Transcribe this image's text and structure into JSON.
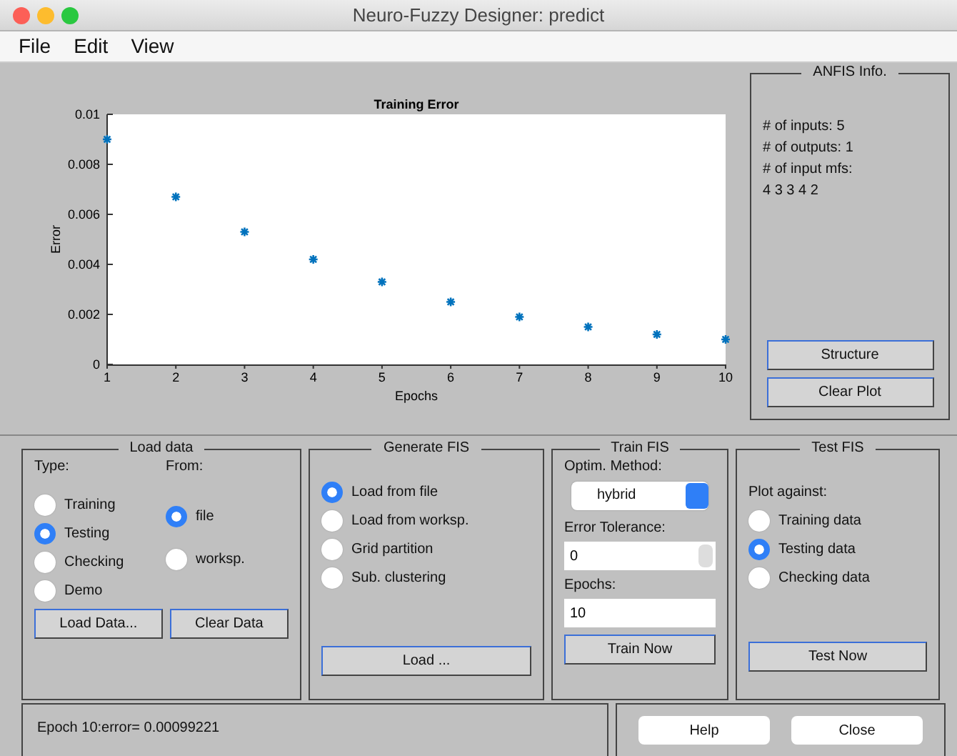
{
  "window": {
    "title": "Neuro-Fuzzy Designer: predict"
  },
  "menu": [
    "File",
    "Edit",
    "View"
  ],
  "chart_data": {
    "type": "scatter",
    "title": "Training Error",
    "xlabel": "Epochs",
    "ylabel": "Error",
    "x": [
      1,
      2,
      3,
      4,
      5,
      6,
      7,
      8,
      9,
      10
    ],
    "series": [
      {
        "color": "#0072bd",
        "values": [
          0.009,
          0.0067,
          0.0053,
          0.0042,
          0.0033,
          0.0025,
          0.0019,
          0.0015,
          0.0012,
          0.001
        ]
      }
    ],
    "xlim": [
      1,
      10
    ],
    "ylim": [
      0,
      0.01
    ],
    "xticks": [
      1,
      2,
      3,
      4,
      5,
      6,
      7,
      8,
      9,
      10
    ],
    "yticks": [
      {
        "value": 0,
        "label": "0"
      },
      {
        "value": 0.002,
        "label": "0.002"
      },
      {
        "value": 0.004,
        "label": "0.004"
      },
      {
        "value": 0.006,
        "label": "0.006"
      },
      {
        "value": 0.008,
        "label": "0.008"
      },
      {
        "value": 0.01,
        "label": "0.01"
      }
    ]
  },
  "anfis_info": {
    "title": "ANFIS Info.",
    "lines": [
      "# of inputs: 5",
      "# of outputs: 1",
      "# of input mfs:",
      "4  3  3  4  2"
    ],
    "buttons": [
      "Structure",
      "Clear Plot"
    ]
  },
  "load_data": {
    "title": "Load data",
    "type_label": "Type:",
    "from_label": "From:",
    "type_options": [
      {
        "label": "Training",
        "selected": false
      },
      {
        "label": "Testing",
        "selected": true
      },
      {
        "label": "Checking",
        "selected": false
      },
      {
        "label": "Demo",
        "selected": false
      }
    ],
    "from_options": [
      {
        "label": "file",
        "selected": true
      },
      {
        "label": "worksp.",
        "selected": false
      }
    ],
    "buttons": [
      "Load Data...",
      "Clear Data"
    ]
  },
  "generate_fis": {
    "title": "Generate FIS",
    "options": [
      {
        "label": "Load from file",
        "selected": true
      },
      {
        "label": "Load from worksp.",
        "selected": false
      },
      {
        "label": "Grid partition",
        "selected": false
      },
      {
        "label": "Sub. clustering",
        "selected": false
      }
    ],
    "button": "Load ..."
  },
  "train_fis": {
    "title": "Train FIS",
    "method_label": "Optim. Method:",
    "method_value": "hybrid",
    "tolerance_label": "Error Tolerance:",
    "tolerance_value": "0",
    "epochs_label": "Epochs:",
    "epochs_value": "10",
    "button": "Train Now"
  },
  "test_fis": {
    "title": "Test FIS",
    "plot_label": "Plot against:",
    "options": [
      {
        "label": "Training data",
        "selected": false
      },
      {
        "label": "Testing data",
        "selected": true
      },
      {
        "label": "Checking data",
        "selected": false
      }
    ],
    "button": "Test Now"
  },
  "status": "Epoch 10:error= 0.00099221",
  "buttons": [
    "Help",
    "Close"
  ]
}
